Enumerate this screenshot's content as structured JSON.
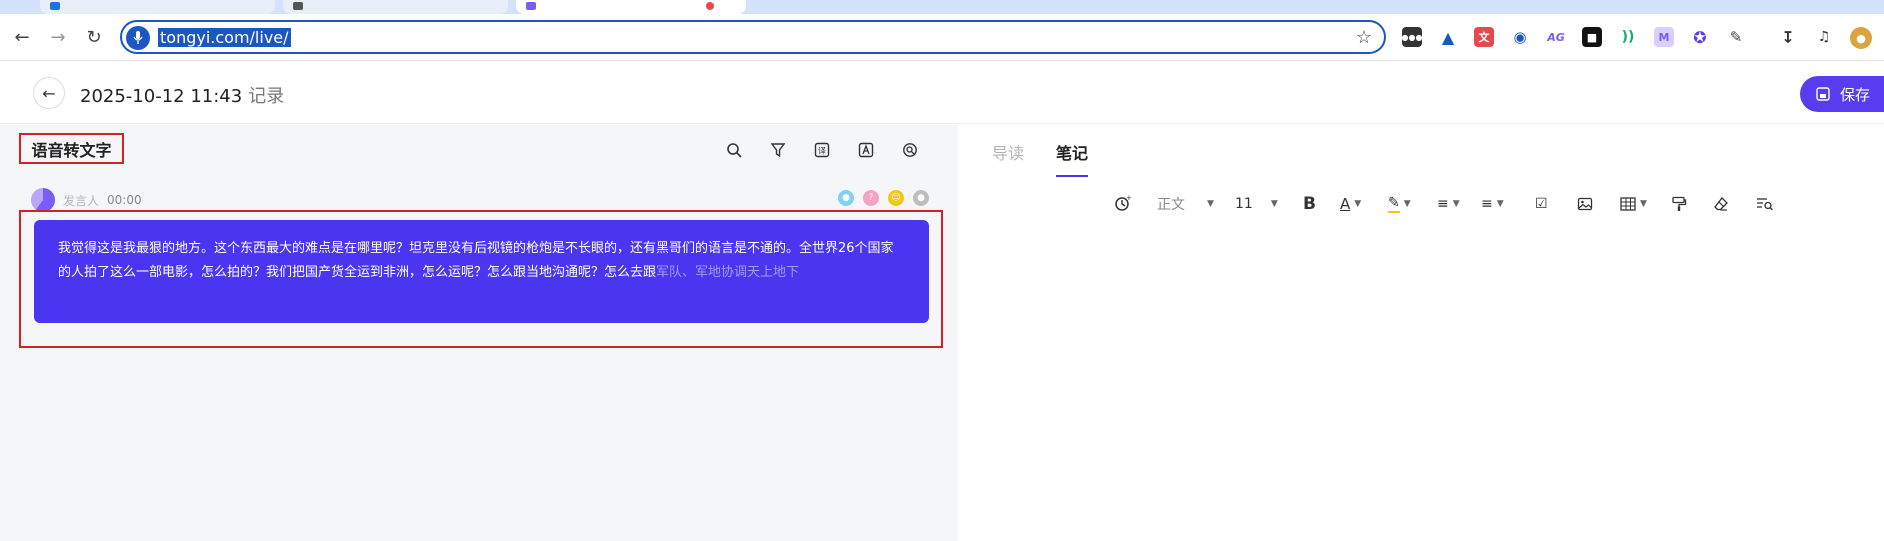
{
  "browser": {
    "url": "tongyi.com/live/"
  },
  "header": {
    "title": "2025-10-12 11:43",
    "subtitle": "记录",
    "save_label": "保存"
  },
  "left_panel": {
    "section_title": "语音转文字",
    "speaker": {
      "name": "发言人",
      "time": "00:00"
    },
    "transcript": {
      "text": "我觉得这是我最狠的地方。这个东西最大的难点是在哪里呢？坦克里没有后视镜的枪炮是不长眼的，还有黑哥们的语言是不通的。全世界26个国家的人拍了这么一部电影，怎么拍的？我们把国产货全运到非洲，怎么运呢？怎么跟当地沟通呢？怎么去跟",
      "pending_text": "军队、军地协调天上地下"
    }
  },
  "right_panel": {
    "tabs": [
      "导读",
      "笔记"
    ],
    "active_tab": "笔记",
    "editor": {
      "paragraph_style": "正文",
      "font_size": "11"
    }
  },
  "colors": {
    "accent": "#4a35f0",
    "save_button": "#5a3cf0",
    "highlight_frame": "#d3202a",
    "url_selection": "#1a57c2"
  }
}
